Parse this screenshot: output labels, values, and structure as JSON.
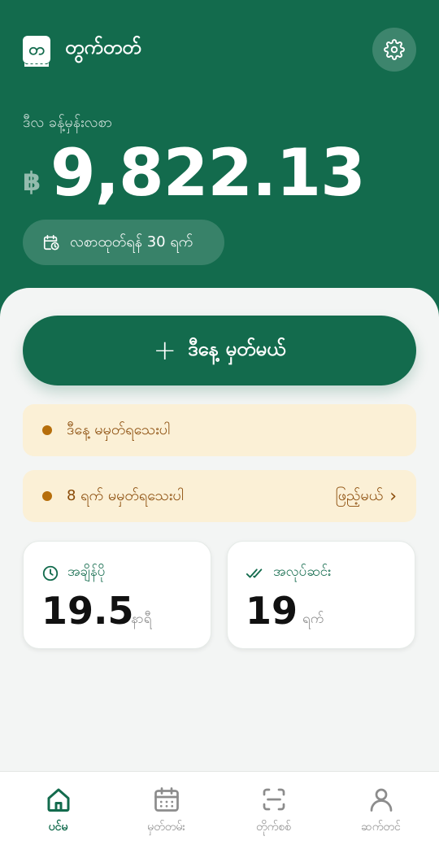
{
  "app": {
    "logo_text": "တ",
    "title": "တွက်တတ်"
  },
  "header": {
    "balance_label": "ဒီလ ခန့်မှန်းလစာ",
    "currency_symbol": "฿",
    "balance": "9,822.13",
    "period_label": "လစာထုတ်ရန် 30 ရက်"
  },
  "primary_action": {
    "plus": "+",
    "label": "ဒီနေ့ မှတ်မယ်"
  },
  "notices": [
    {
      "text": "ဒီနေ့ မမှတ်ရသေးပါ"
    },
    {
      "text": "8 ရက် မမှတ်ရသေးပါ",
      "action": "ဖြည့်မယ်",
      "chevron": "›"
    }
  ],
  "stats": {
    "hours": {
      "title": "အချိန်ပို",
      "value": "19.5",
      "unit": "နာရီ"
    },
    "workdays": {
      "title": "အလုပ်ဆင်း",
      "value": "19",
      "unit": "ရက်"
    }
  },
  "nav": {
    "home": {
      "label": "ပင်မ",
      "active": true
    },
    "records": {
      "label": "မှတ်တမ်း"
    },
    "scan": {
      "label": "တိုက်စစ်"
    },
    "profile": {
      "label": "ဆက်တင်"
    }
  },
  "colors": {
    "primary": "#136b4d",
    "warning_bg": "#fbf0d6",
    "warning_text": "#8a4b09",
    "warning_dot": "#b66e0b"
  }
}
